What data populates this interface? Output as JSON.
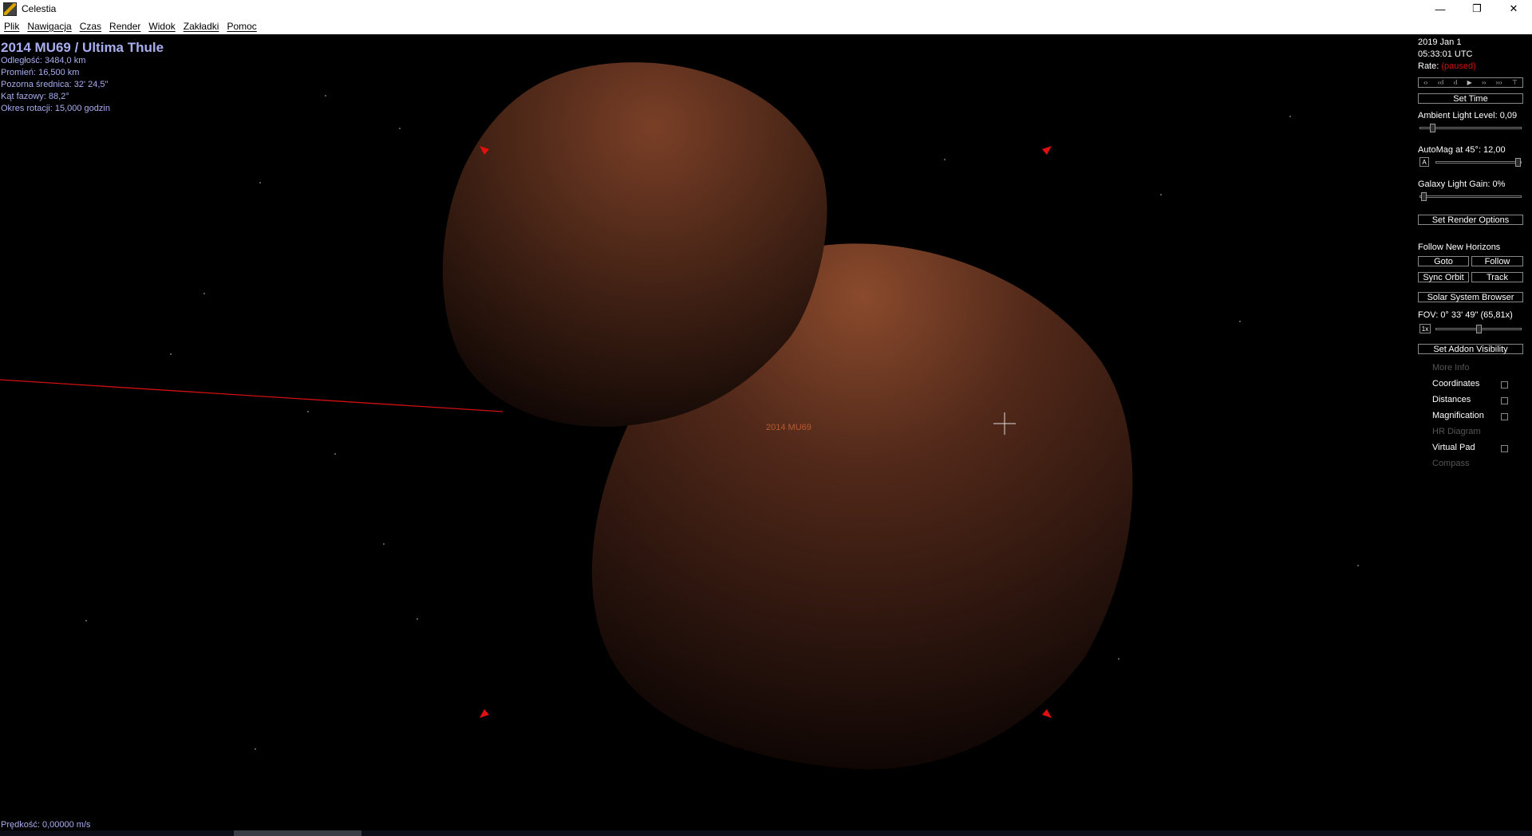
{
  "window": {
    "title": "Celestia",
    "minimize": "—",
    "maximize": "❐",
    "close": "✕"
  },
  "menu": [
    "Plik",
    "Nawigacja",
    "Czas",
    "Render",
    "Widok",
    "Zakładki",
    "Pomoc"
  ],
  "hud": {
    "object_name": "2014 MU69 / Ultima Thule",
    "lines": [
      "Odległość: 3484,0 km",
      "Promień: 16,500 km",
      "Pozorna średnica: 32' 24,5\"",
      "Kąt fazowy: 88,2°",
      "Okres rotacji: 15,000 godzin"
    ],
    "speed": "Prędkość: 0,00000 m/s",
    "object_label": "2014 MU69"
  },
  "panel": {
    "date": "2019 Jan 1",
    "time": "05:33:01 UTC",
    "rate_label": "Rate:",
    "rate_value": "(paused)",
    "time_controls": [
      "‹›",
      "‹‹I",
      "‹I",
      "▶",
      "››",
      "›››",
      "⊤"
    ],
    "set_time": "Set Time",
    "ambient_label": "Ambient Light Level: 0,09",
    "ambient_value": 0.09,
    "automag_label": "AutoMag at 45°: 12,00",
    "automag_button": "A",
    "galaxy_label": "Galaxy Light Gain: 0%",
    "set_render_options": "Set Render Options",
    "follow_label": "Follow New Horizons",
    "goto": "Goto",
    "follow": "Follow",
    "sync_orbit": "Sync Orbit",
    "track": "Track",
    "solar_browser": "Solar System Browser",
    "fov_label": "FOV: 0° 33' 49\" (65,81x)",
    "fov_button": "1x",
    "set_addon_visibility": "Set Addon Visibility",
    "more_info": "More Info",
    "coordinates": "Coordinates",
    "distances": "Distances",
    "magnification": "Magnification",
    "hr_diagram": "HR Diagram",
    "virtual_pad": "Virtual Pad",
    "compass": "Compass"
  },
  "colors": {
    "hud_text": "#a8aef0",
    "paused": "#d01010",
    "marker": "#e01010",
    "body": "#5a3020",
    "label": "#b85a30"
  }
}
